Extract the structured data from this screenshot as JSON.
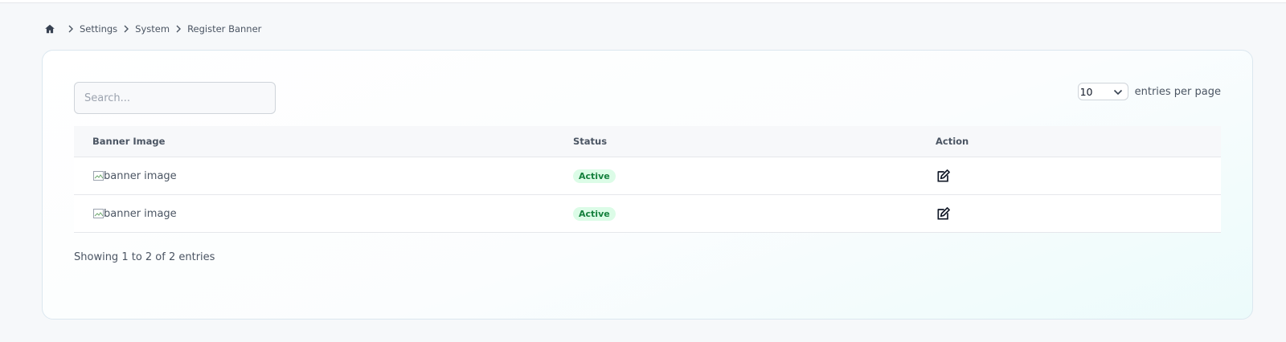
{
  "breadcrumb": {
    "home_icon": "home-icon",
    "items": [
      "Settings",
      "System",
      "Register Banner"
    ]
  },
  "search": {
    "placeholder": "Search...",
    "value": ""
  },
  "pagination": {
    "page_size": "10",
    "per_page_label": "entries per page"
  },
  "table": {
    "columns": [
      "Banner Image",
      "Status",
      "Action"
    ],
    "rows": [
      {
        "image_alt": "banner image",
        "status": "Active",
        "action_icon": "edit-icon"
      },
      {
        "image_alt": "banner image",
        "status": "Active",
        "action_icon": "edit-icon"
      }
    ]
  },
  "footer": {
    "info": "Showing 1 to 2 of 2 entries"
  },
  "colors": {
    "status_active_bg": "#dcfce7",
    "status_active_text": "#15803d"
  }
}
